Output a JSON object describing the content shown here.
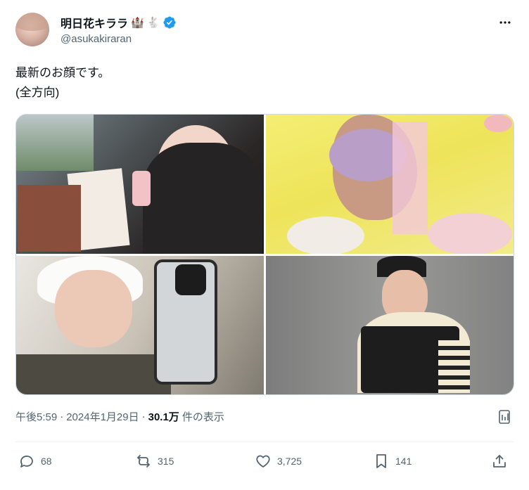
{
  "author": {
    "display_name": "明日花キララ",
    "emoji_1": "🏰",
    "emoji_2": "🐇",
    "handle": "@asukakiraran"
  },
  "tweet": {
    "line1": "最新のお顔です。",
    "line2": "(全方向)"
  },
  "meta": {
    "time": "午後5:59",
    "sep1": "·",
    "date": "2024年1月29日",
    "sep2": "·",
    "views_count": "30.1万",
    "views_label": "件の表示"
  },
  "actions": {
    "replies": "68",
    "reposts": "315",
    "likes": "3,725",
    "bookmarks": "141"
  },
  "colors": {
    "text": "#0f1419",
    "secondary": "#536471",
    "verified": "#1d9bf0",
    "border": "#cfd9de"
  }
}
